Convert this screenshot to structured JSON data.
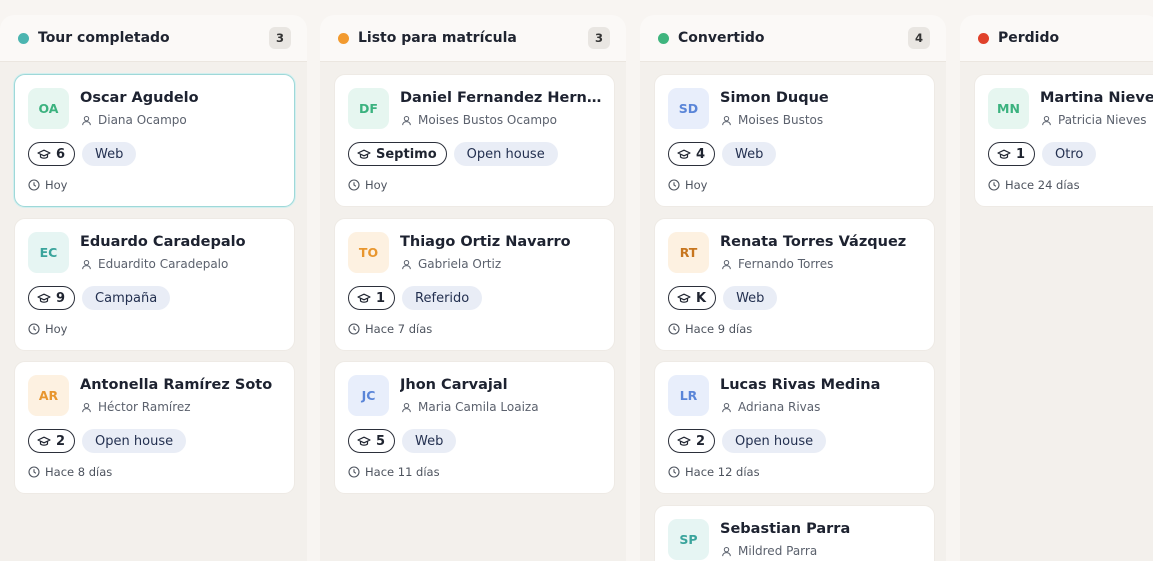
{
  "colors": {
    "teal": "#4bb5b0",
    "orange": "#f29a2e",
    "green": "#3fb57e",
    "red": "#e0412a"
  },
  "columns": [
    {
      "title": "Tour completado",
      "count": "3",
      "cards": [
        {
          "initials": "OA",
          "name": "Oscar Agudelo",
          "parent": "Diana Ocampo",
          "grade": "6",
          "source": "Web",
          "time": "Hoy"
        },
        {
          "initials": "EC",
          "name": "Eduardo Caradepalo",
          "parent": "Eduardito Caradepalo",
          "grade": "9",
          "source": "Campaña",
          "time": "Hoy"
        },
        {
          "initials": "AR",
          "name": "Antonella Ramírez Soto",
          "parent": "Héctor Ramírez",
          "grade": "2",
          "source": "Open house",
          "time": "Hace 8 días"
        }
      ]
    },
    {
      "title": "Listo para matrícula",
      "count": "3",
      "cards": [
        {
          "initials": "DF",
          "name": "Daniel Fernandez Hernand...",
          "parent": "Moises Bustos Ocampo",
          "grade": "Septimo",
          "source": "Open house",
          "time": "Hoy"
        },
        {
          "initials": "TO",
          "name": "Thiago Ortiz Navarro",
          "parent": "Gabriela Ortiz",
          "grade": "1",
          "source": "Referido",
          "time": "Hace 7 días"
        },
        {
          "initials": "JC",
          "name": "Jhon Carvajal",
          "parent": "Maria Camila Loaiza",
          "grade": "5",
          "source": "Web",
          "time": "Hace 11 días"
        }
      ]
    },
    {
      "title": "Convertido",
      "count": "4",
      "cards": [
        {
          "initials": "SD",
          "name": "Simon Duque",
          "parent": "Moises Bustos",
          "grade": "4",
          "source": "Web",
          "time": "Hoy"
        },
        {
          "initials": "RT",
          "name": "Renata Torres Vázquez",
          "parent": "Fernando Torres",
          "grade": "K",
          "source": "Web",
          "time": "Hace 9 días"
        },
        {
          "initials": "LR",
          "name": "Lucas Rivas Medina",
          "parent": "Adriana Rivas",
          "grade": "2",
          "source": "Open house",
          "time": "Hace 12 días"
        },
        {
          "initials": "SP",
          "name": "Sebastian Parra",
          "parent": "Mildred Parra",
          "grade": "",
          "source": "",
          "time": ""
        }
      ]
    },
    {
      "title": "Perdido",
      "count": "",
      "cards": [
        {
          "initials": "MN",
          "name": "Martina Nieves A",
          "parent": "Patricia Nieves",
          "grade": "1",
          "source": "Otro",
          "time": "Hace 24 días"
        }
      ]
    }
  ]
}
